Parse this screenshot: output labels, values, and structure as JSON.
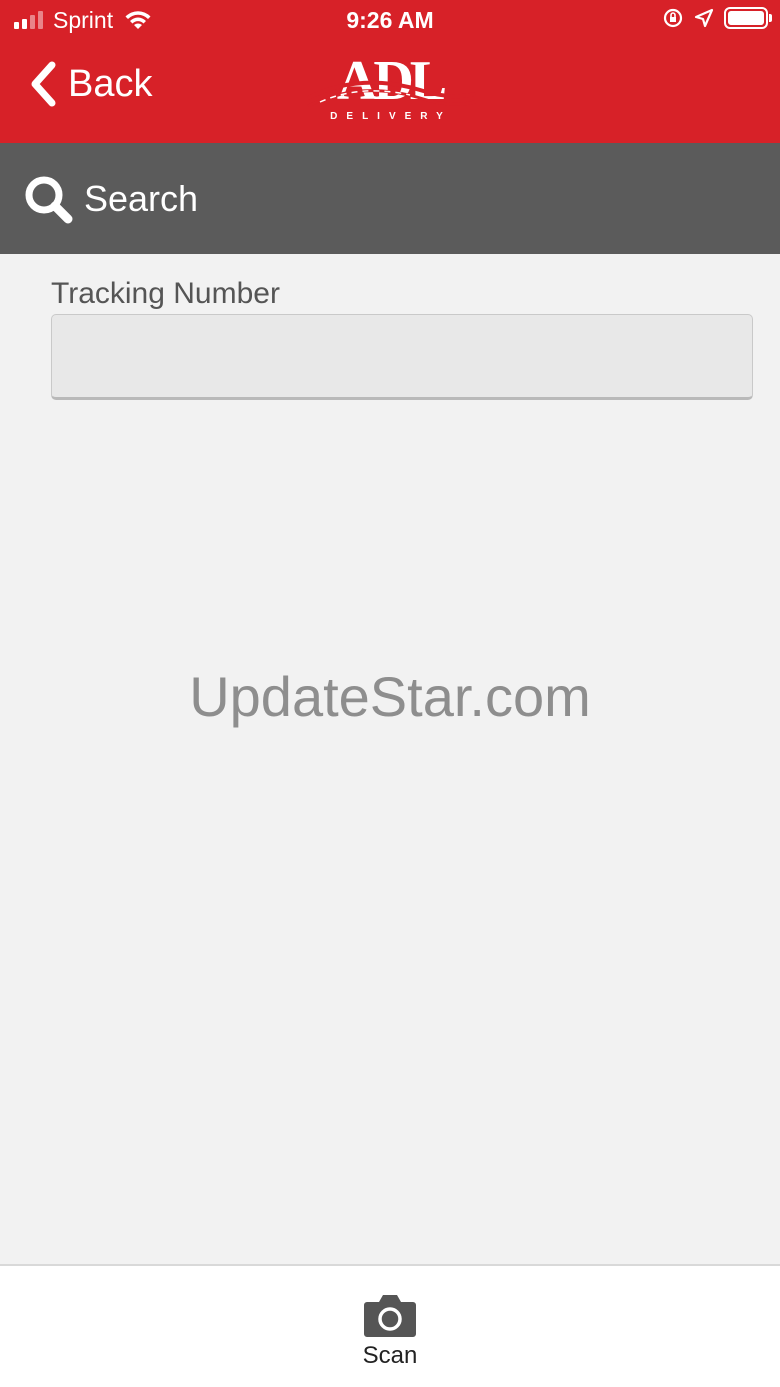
{
  "status_bar": {
    "carrier": "Sprint",
    "time": "9:26 AM",
    "battery_level": 1.0
  },
  "nav": {
    "back_label": "Back",
    "logo_text": "ADL",
    "logo_subtext": "DELIVERY"
  },
  "header": {
    "title": "Search"
  },
  "form": {
    "tracking_label": "Tracking Number",
    "tracking_value": "",
    "tracking_placeholder": ""
  },
  "watermark": "UpdateStar.com",
  "tabbar": {
    "scan_label": "Scan"
  },
  "colors": {
    "brand_red": "#d72128",
    "header_gray": "#5b5b5b",
    "background": "#f2f2f2"
  },
  "icons": [
    "signal-icon",
    "wifi-icon",
    "orientation-lock-icon",
    "location-icon",
    "battery-icon",
    "chevron-left-icon",
    "search-icon",
    "camera-icon"
  ]
}
